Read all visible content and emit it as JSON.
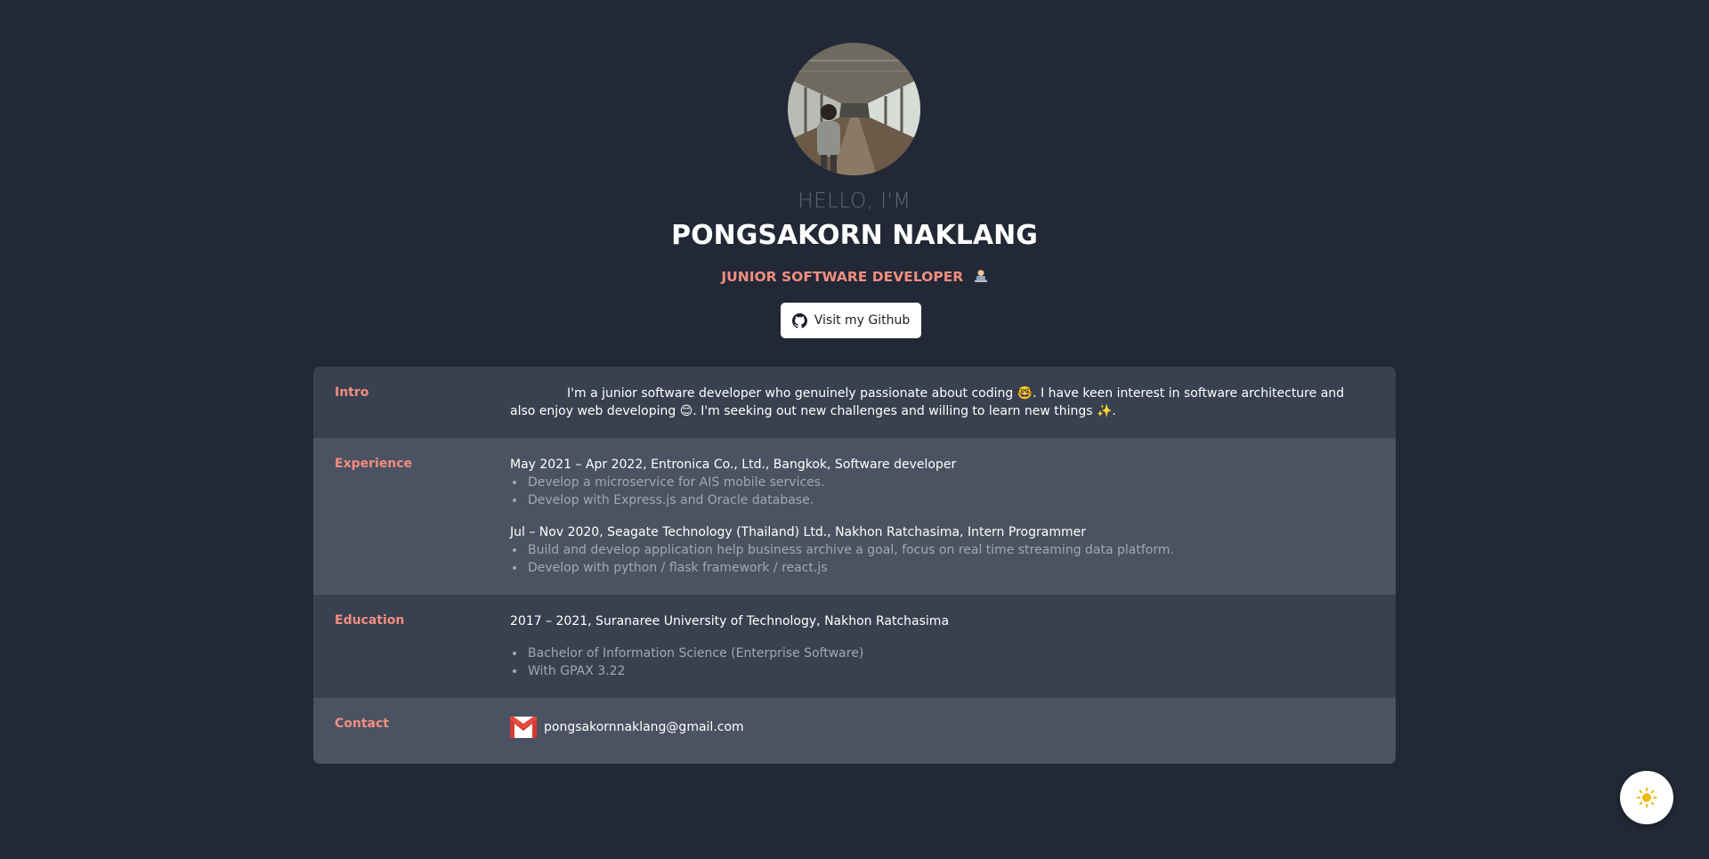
{
  "hero": {
    "greeting": "HELLO, I'M",
    "name": "PONGSAKORN NAKLANG",
    "role": "JUNIOR SOFTWARE DEVELOPER",
    "github_button": "Visit my Github"
  },
  "sections": {
    "intro": {
      "label": "Intro",
      "text": "I'm a junior software developer who genuinely passionate about coding 🤓. I have keen interest in software architecture and also enjoy web developing 😊. I'm seeking out new challenges and willing to learn new things ✨."
    },
    "experience": {
      "label": "Experience",
      "jobs": [
        {
          "title": "May 2021 – Apr 2022, Entronica Co., Ltd., Bangkok, Software developer",
          "bullets": [
            "Develop a microservice for AIS mobile services.",
            "Develop with Express.js and Oracle database."
          ]
        },
        {
          "title": "Jul – Nov 2020, Seagate Technology (Thailand) Ltd., Nakhon Ratchasima, Intern Programmer",
          "bullets": [
            "Build and develop application help business archive a goal, focus on real time streaming data platform.",
            "Develop with python / flask framework / react.js"
          ]
        }
      ]
    },
    "education": {
      "label": "Education",
      "title": "2017 – 2021, Suranaree University of Technology, Nakhon Ratchasima",
      "bullets": [
        "Bachelor of Information Science (Enterprise Software)",
        "With GPAX 3.22"
      ]
    },
    "contact": {
      "label": "Contact",
      "email": "pongsakornnaklang@gmail.com"
    }
  },
  "colors": {
    "background": "#222836",
    "accent": "#f08e80",
    "row_dark": "#394050",
    "row_light": "#4b5261"
  },
  "icons": {
    "role": "technologist-emoji",
    "github": "github-icon",
    "email": "gmail-icon",
    "theme_toggle": "sun-icon"
  }
}
